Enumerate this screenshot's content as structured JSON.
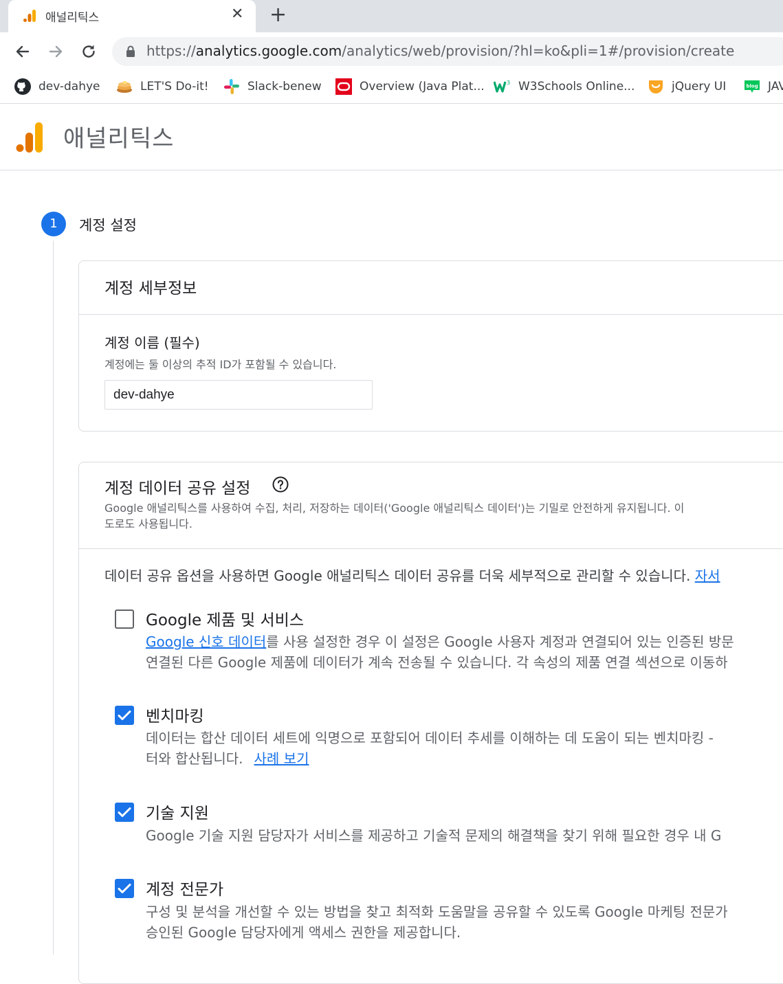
{
  "browser": {
    "tab_title": "애널리틱스",
    "url_prefix": "https://",
    "url_host": "analytics.google.com",
    "url_path": "/analytics/web/provision/?hl=ko&pli=1#/provision/create",
    "bookmarks": [
      {
        "label": "dev-dahye",
        "icon": "github-icon"
      },
      {
        "label": "LET'S Do-it!",
        "icon": "pancake-icon"
      },
      {
        "label": "Slack-benew",
        "icon": "slack-icon"
      },
      {
        "label": "Overview (Java Plat...",
        "icon": "oracle-icon"
      },
      {
        "label": "W3Schools Online...",
        "icon": "w3schools-icon"
      },
      {
        "label": "jQuery UI",
        "icon": "jquery-ui-icon"
      },
      {
        "label": "JAV",
        "icon": "blog-icon"
      }
    ]
  },
  "app": {
    "title": "애널리틱스",
    "brand_color": "#F9AB00"
  },
  "stepper": {
    "number": "1",
    "title": "계정 설정",
    "accent": "#1A73E8"
  },
  "account_details": {
    "title": "계정 세부정보",
    "name_label": "계정 이름 (필수)",
    "name_hint": "계정에는 둘 이상의 추적 ID가 포함될 수 있습니다.",
    "name_value": "dev-dahye"
  },
  "sharing": {
    "title": "계정 데이터 공유 설정",
    "desc_line1": "Google 애널리틱스를 사용하여 수집, 처리, 저장하는 데이터('Google 애널리틱스 데이터')는 기밀로 안전하게 유지됩니다. 이",
    "desc_line2": "도로도 사용됩니다.",
    "intro_text": "데이터 공유 옵션을 사용하면 Google 애널리틱스 데이터 공유를 더욱 세부적으로 관리할 수 있습니다. ",
    "intro_link": "자서",
    "options": [
      {
        "title": "Google 제품 및 서비스",
        "checked": false,
        "link": "Google 신호 데이터",
        "line1_rest": "를 사용 설정한 경우 이 설정은 Google 사용자 계정과 연결되어 있는 인증된 방문",
        "line2": "연결된 다른 Google 제품에 데이터가 계속 전송될 수 있습니다. 각 속성의 제품 연결 섹션으로 이동하"
      },
      {
        "title": "벤치마킹",
        "checked": true,
        "line1": "데이터는 합산 데이터 세트에 익명으로 포함되어 데이터 추세를 이해하는 데 도움이 되는 벤치마킹 -",
        "line2": "터와 합산됩니다.",
        "link": "사례 보기"
      },
      {
        "title": "기술 지원",
        "checked": true,
        "line1": "Google 기술 지원 담당자가 서비스를 제공하고 기술적 문제의 해결책을 찾기 위해 필요한 경우 내 G"
      },
      {
        "title": "계정 전문가",
        "checked": true,
        "line1": "구성 및 분석을 개선할 수 있는 방법을 찾고 최적화 도움말을 공유할 수 있도록 Google 마케팅 전문가",
        "line2": "승인된 Google 담당자에게 액세스 권한을 제공합니다."
      }
    ]
  }
}
